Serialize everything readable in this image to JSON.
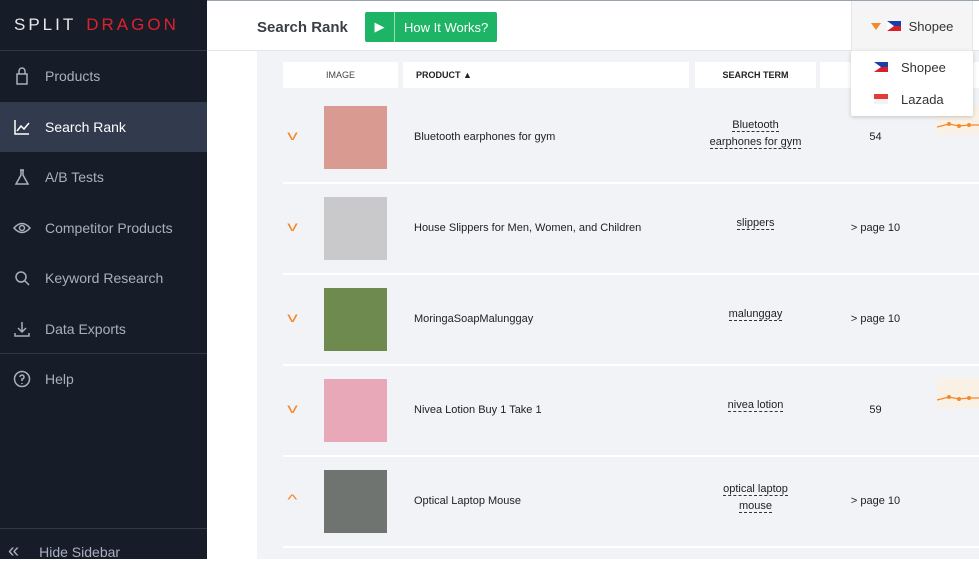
{
  "brand": {
    "part1": "SPLIT",
    "part2": "DRAGON"
  },
  "sidebar": {
    "items": [
      {
        "label": "Products",
        "icon": "bag-icon"
      },
      {
        "label": "Search Rank",
        "icon": "chart-line-icon",
        "active": true
      },
      {
        "label": "A/B Tests",
        "icon": "flask-icon"
      },
      {
        "label": "Competitor Products",
        "icon": "eye-icon"
      },
      {
        "label": "Keyword Research",
        "icon": "search-icon"
      },
      {
        "label": "Data Exports",
        "icon": "download-icon"
      },
      {
        "label": "Help",
        "icon": "help-icon"
      }
    ],
    "hide_label": "Hide Sidebar"
  },
  "header": {
    "title": "Search Rank",
    "how_label": "How It Works?",
    "marketplace": "Shopee"
  },
  "dropdown": {
    "options": [
      "Shopee",
      "Lazada"
    ]
  },
  "table": {
    "headers": {
      "image": "IMAGE",
      "product": "PRODUCT ▲",
      "term": "SEARCH TERM"
    },
    "rows": [
      {
        "product": "Bluetooth earphones for gym",
        "term1": "Bluetooth",
        "term2": "earphones for gym",
        "rank": "54",
        "expanded": false,
        "color": "#d99a92"
      },
      {
        "product": "House Slippers for Men, Women, and Children",
        "term1": "slippers",
        "term2": "",
        "rank": "> page 10",
        "expanded": false,
        "color": "#c9c9cc"
      },
      {
        "product": "MoringaSoapMalunggay",
        "term1": "malunggay",
        "term2": "",
        "rank": "> page 10",
        "expanded": false,
        "color": "#6e8a4e"
      },
      {
        "product": "Nivea Lotion Buy 1 Take 1",
        "term1": "nivea lotion",
        "term2": "",
        "rank": "59",
        "expanded": false,
        "color": "#e8a8b8"
      },
      {
        "product": "Optical Laptop Mouse",
        "term1": "optical laptop",
        "term2": "mouse",
        "rank": "> page 10",
        "expanded": true,
        "color": "#6f7470"
      }
    ]
  },
  "colors": {
    "accent": "#f5892a",
    "green": "#1eb466",
    "sidebar": "#161d29"
  }
}
